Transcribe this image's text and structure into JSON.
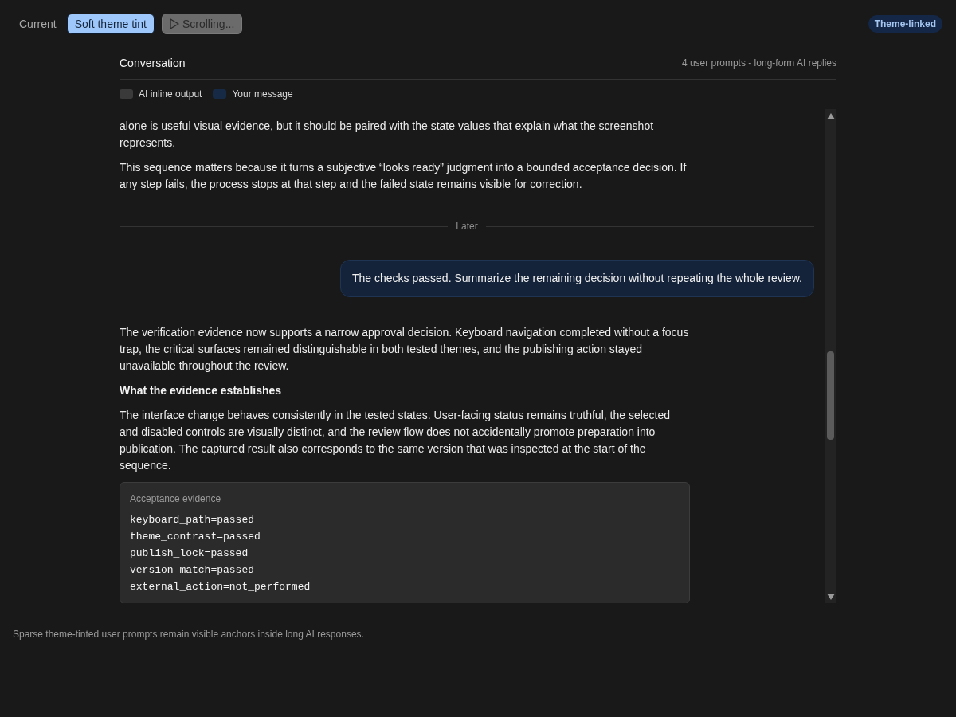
{
  "view_tabs": [
    {
      "label": "Current",
      "selected": false
    },
    {
      "label": "Soft theme tint",
      "selected": true
    }
  ],
  "scroll_button": {
    "label": "Scrolling...",
    "disabled": true
  },
  "badge": "Theme-linked",
  "conversation": {
    "title": "Conversation",
    "summary": "4 user prompts - long-form AI replies",
    "legend": [
      {
        "label": "AI inline output",
        "color": "#3a3a3a"
      },
      {
        "label": "Your message",
        "color": "#172a45"
      }
    ],
    "messages": [
      {
        "kind": "ai",
        "blocks": [
          {
            "kind": "paragraph",
            "text": "alone is useful visual evidence, but it should be paired with the state values that explain what the screenshot represents."
          },
          {
            "kind": "paragraph",
            "text": "This sequence matters because it turns a subjective “looks ready” judgment into a bounded acceptance decision. If any step fails, the process stops at that step and the failed state remains visible for correction."
          }
        ]
      },
      {
        "kind": "divider",
        "label": "Later"
      },
      {
        "kind": "user",
        "text": "The checks passed. Summarize the remaining decision without repeating the whole review."
      },
      {
        "kind": "ai",
        "blocks": [
          {
            "kind": "paragraph",
            "text": "The verification evidence now supports a narrow approval decision. Keyboard navigation completed without a focus trap, the critical surfaces remained distinguishable in both tested themes, and the publishing action stayed unavailable throughout the review."
          },
          {
            "kind": "heading",
            "text": "What the evidence establishes"
          },
          {
            "kind": "paragraph",
            "text": "The interface change behaves consistently in the tested states. User-facing status remains truthful, the selected and disabled controls are visually distinct, and the review flow does not accidentally promote preparation into publication. The captured result also corresponds to the same version that was inspected at the start of the sequence."
          },
          {
            "kind": "code",
            "label": "Acceptance evidence",
            "lines": [
              "keyboard_path=passed",
              "theme_contrast=passed",
              "publish_lock=passed",
              "version_match=passed",
              "external_action=not_performed"
            ]
          }
        ]
      }
    ]
  },
  "footer": "Sparse theme-tinted user prompts remain visible anchors inside long AI responses."
}
